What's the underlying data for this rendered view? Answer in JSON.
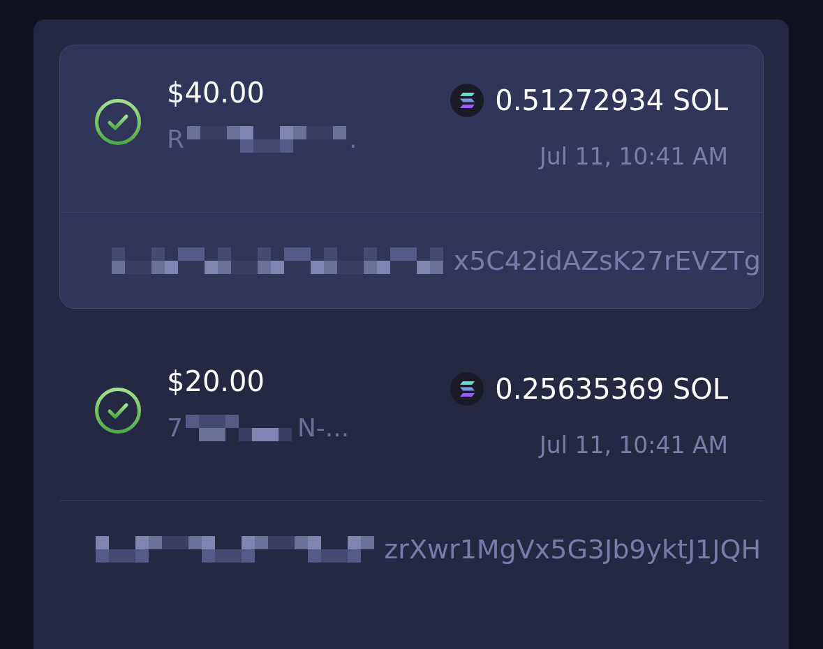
{
  "transactions": [
    {
      "selected": true,
      "completed": true,
      "amount": "$40.00",
      "recipient_start": "R",
      "recipient_end": ".",
      "token_amount": "0.51272934 SOL",
      "date": "Jul 11, 10:41 AM",
      "hash_end": "x5C42idAZsK27rEVZTg"
    },
    {
      "selected": false,
      "completed": true,
      "amount": "$20.00",
      "recipient_start": "7",
      "recipient_end": "N-...",
      "token_amount": "0.25635369 SOL",
      "date": "Jul 11, 10:41 AM",
      "hash_end": "zrXwr1MgVx5G3Jb9yktJ1JQH"
    }
  ]
}
